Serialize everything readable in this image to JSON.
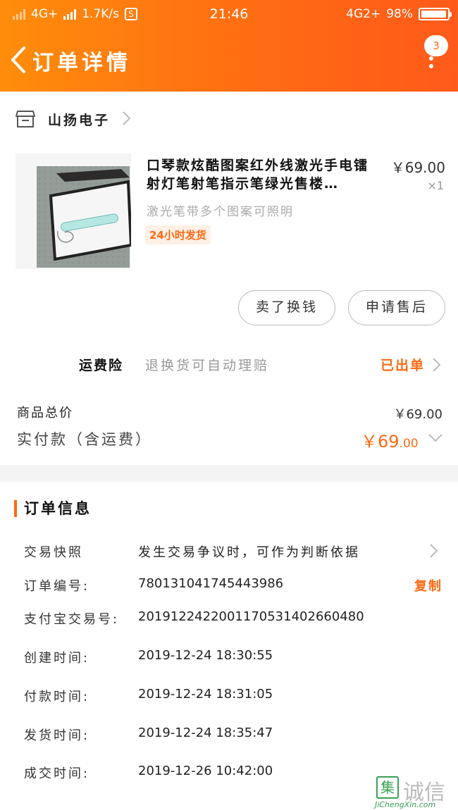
{
  "status_bar": {
    "network1": "4G+",
    "speed": "1.7K/s",
    "s_icon": "S",
    "time": "21:46",
    "network2": "4G2+",
    "battery": "98%",
    "battery_level": 0.98
  },
  "nav": {
    "title": "订单详情",
    "badge": "3",
    "back_icon": "chevron-left-icon",
    "more_icon": "more-vertical-icon"
  },
  "shop": {
    "name": "山扬电子",
    "icon": "store-icon"
  },
  "product": {
    "title": "口琴款炫酷图案红外线激光手电镭射灯笔射笔指示笔绿光售楼…",
    "price": "￥69.00",
    "quantity": "×1",
    "spec": "激光笔带多个图案可照明",
    "tag": "24小时发货"
  },
  "actions": {
    "sell_label": "卖了换钱",
    "after_sale_label": "申请售后"
  },
  "insurance": {
    "label": "运费险",
    "desc": "退换货可自动理赔",
    "status": "已出单"
  },
  "totals": {
    "goods_label": "商品总价",
    "goods_value": "￥69.00",
    "paid_label": "实付款（含运费）",
    "paid_value_main": "￥69",
    "paid_value_cents": ".00"
  },
  "order_info": {
    "title": "订单信息",
    "snapshot_label": "交易快照",
    "snapshot_value": "发生交易争议时，可作为判断依据",
    "order_no_label": "订单编号:",
    "order_no": "780131041745443986",
    "copy_label": "复制",
    "alipay_label": "支付宝交易号:",
    "alipay_no": "2019122422001170531402660480",
    "created_label": "创建时间:",
    "created_time": "2019-12-24 18:30:55",
    "paid_label": "付款时间:",
    "paid_time": "2019-12-24 18:31:05",
    "shipped_label": "发货时间:",
    "shipped_time": "2019-12-24 18:35:47",
    "done_label": "成交时间:",
    "done_time": "2019-12-26 10:42:00"
  },
  "watermark": {
    "logo_char": "集",
    "text": "诚信",
    "url": "JiChengXin.com"
  },
  "colors": {
    "accent": "#ff6a14",
    "header_start": "#ff8d0b",
    "header_end": "#ff5a1a"
  }
}
